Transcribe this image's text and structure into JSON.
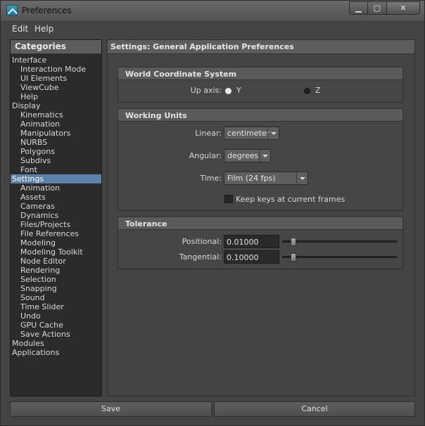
{
  "window": {
    "title": "Preferences"
  },
  "window_controls": {
    "minimize": "▁",
    "maximize": "▢",
    "close": "✕"
  },
  "menu": {
    "edit": "Edit",
    "help": "Help"
  },
  "categories": {
    "header": "Categories",
    "items": [
      {
        "label": "Interface",
        "level": 0
      },
      {
        "label": "Interaction Mode",
        "level": 1
      },
      {
        "label": "UI Elements",
        "level": 1
      },
      {
        "label": "ViewCube",
        "level": 1
      },
      {
        "label": "Help",
        "level": 1
      },
      {
        "label": "Display",
        "level": 0
      },
      {
        "label": "Kinematics",
        "level": 1
      },
      {
        "label": "Animation",
        "level": 1
      },
      {
        "label": "Manipulators",
        "level": 1
      },
      {
        "label": "NURBS",
        "level": 1
      },
      {
        "label": "Polygons",
        "level": 1
      },
      {
        "label": "Subdivs",
        "level": 1
      },
      {
        "label": "Font",
        "level": 1
      },
      {
        "label": "Settings",
        "level": 0,
        "selected": true
      },
      {
        "label": "Animation",
        "level": 1
      },
      {
        "label": "Assets",
        "level": 1
      },
      {
        "label": "Cameras",
        "level": 1
      },
      {
        "label": "Dynamics",
        "level": 1
      },
      {
        "label": "Files/Projects",
        "level": 1
      },
      {
        "label": "File References",
        "level": 1
      },
      {
        "label": "Modeling",
        "level": 1
      },
      {
        "label": "Modeling Toolkit",
        "level": 1
      },
      {
        "label": "Node Editor",
        "level": 1
      },
      {
        "label": "Rendering",
        "level": 1
      },
      {
        "label": "Selection",
        "level": 1
      },
      {
        "label": "Snapping",
        "level": 1
      },
      {
        "label": "Sound",
        "level": 1
      },
      {
        "label": "Time Slider",
        "level": 1
      },
      {
        "label": "Undo",
        "level": 1
      },
      {
        "label": "GPU Cache",
        "level": 1
      },
      {
        "label": "Save Actions",
        "level": 1
      },
      {
        "label": "Modules",
        "level": 0
      },
      {
        "label": "Applications",
        "level": 0
      }
    ]
  },
  "settings": {
    "header": "Settings: General Application Preferences",
    "world": {
      "title": "World Coordinate System",
      "up_axis_label": "Up axis:",
      "options": [
        "Y",
        "Z"
      ],
      "selected": "Y"
    },
    "units": {
      "title": "Working Units",
      "linear_label": "Linear:",
      "linear_value": "centimeter",
      "angular_label": "Angular:",
      "angular_value": "degrees",
      "time_label": "Time:",
      "time_value": "Film (24 fps)",
      "keep_keys_label": "Keep keys at current frames",
      "keep_keys_checked": false
    },
    "tolerance": {
      "title": "Tolerance",
      "positional_label": "Positional:",
      "positional_value": "0.01000",
      "positional_slider": 0.1,
      "tangential_label": "Tangential:",
      "tangential_value": "0.10000",
      "tangential_slider": 0.1
    }
  },
  "buttons": {
    "save": "Save",
    "cancel": "Cancel"
  },
  "colors": {
    "selection": "#5b82a8",
    "panel_bg": "#444444",
    "list_bg": "#2b2b2b"
  }
}
